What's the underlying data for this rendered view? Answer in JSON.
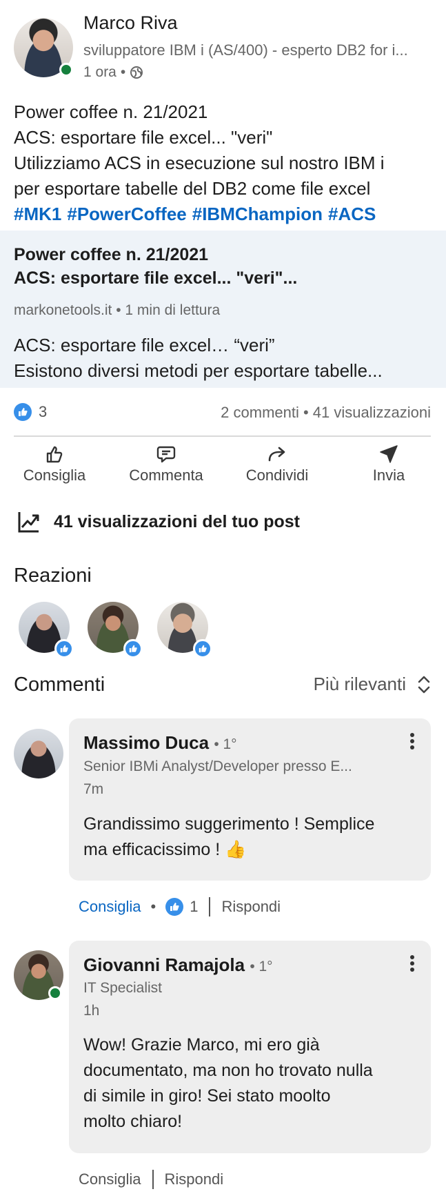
{
  "post": {
    "author": {
      "name": "Marco Riva",
      "headline": "sviluppatore IBM i (AS/400) - esperto DB2 for i...",
      "time": "1 ora",
      "visibility_icon": "globe-icon"
    },
    "text_lines": [
      "Power coffee n. 21/2021",
      "ACS: esportare file excel... \"veri\"",
      "Utilizziamo ACS in esecuzione sul nostro IBM i",
      "per esportare tabelle del DB2 come file excel"
    ],
    "hashtags": [
      "#MK1",
      "#PowerCoffee",
      "#IBMChampion",
      "#ACS"
    ],
    "article": {
      "title_lines": [
        "Power coffee n. 21/2021",
        "ACS: esportare file excel... \"veri\"..."
      ],
      "source": "markonetools.it • 1 min di lettura",
      "excerpt_lines": [
        "ACS: esportare file excel… “veri”",
        "Esistono diversi metodi per esportare tabelle..."
      ]
    },
    "reactions_count": "3",
    "counts_text": "2 commenti • 41 visualizzazioni"
  },
  "actions": [
    {
      "label": "Consiglia",
      "icon": "thumbs-up-icon"
    },
    {
      "label": "Commenta",
      "icon": "comment-icon"
    },
    {
      "label": "Condividi",
      "icon": "share-icon"
    },
    {
      "label": "Invia",
      "icon": "send-icon"
    }
  ],
  "views_text": "41 visualizzazioni del tuo post",
  "reactions_title": "Reazioni",
  "comments_title": "Commenti",
  "sort_label": "Più rilevanti",
  "comments": [
    {
      "name": "Massimo Duca",
      "degree": "• 1°",
      "headline": "Senior IBMi Analyst/Developer presso E...",
      "time": "7m",
      "text_lines": [
        "Grandissimo suggerimento ! Semplice",
        "ma efficacissimo ! 👍"
      ],
      "like_label": "Consiglia",
      "like_count": "1",
      "reply_label": "Rispondi"
    },
    {
      "name": "Giovanni Ramajola",
      "degree": "• 1°",
      "headline": "IT Specialist",
      "time": "1h",
      "text_lines": [
        "Wow! Grazie Marco, mi ero già",
        "documentato, ma non ho trovato nulla",
        "di simile in giro! Sei stato moolto",
        "molto chiaro!"
      ],
      "like_label": "Consiglia",
      "reply_label": "Rispondi"
    }
  ],
  "colors": {
    "accent": "#0a66c2",
    "like_badge": "#378fe9",
    "online": "#15803d",
    "article_bg": "#eef3f8",
    "comment_bg": "#eeeeee"
  }
}
